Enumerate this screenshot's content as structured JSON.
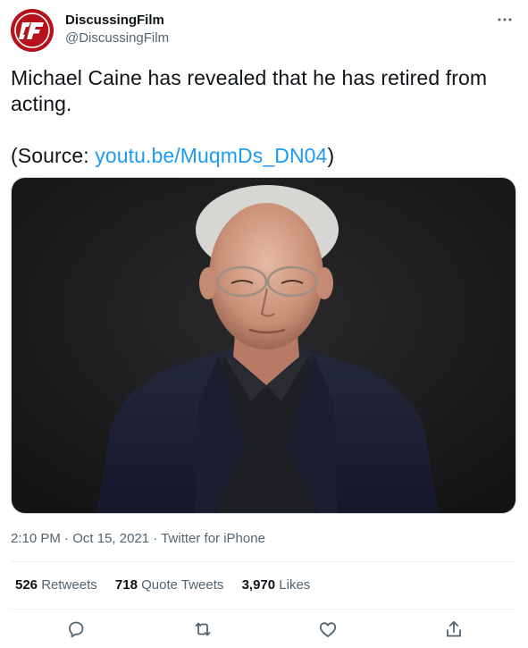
{
  "author": {
    "display_name": "DiscussingFilm",
    "handle": "@DiscussingFilm",
    "avatar_icon": "discussingfilm-logo-icon",
    "avatar_color": "#b5121b"
  },
  "menu": {
    "more_icon": "more-horizontal-icon"
  },
  "tweet": {
    "text": "Michael Caine has revealed that he has retired from acting.",
    "source_prefix": "(Source: ",
    "source_link": "youtu.be/MuqmDs_DN04",
    "source_suffix": ")",
    "link_color": "#1d9bf0"
  },
  "media": {
    "icon": "portrait-photo",
    "background_color": "#1b1b1d"
  },
  "meta": {
    "time": "2:10 PM",
    "separator": "·",
    "date": "Oct 15, 2021",
    "client": "Twitter for iPhone"
  },
  "stats": {
    "retweets_count": "526",
    "retweets_label": "Retweets",
    "quotes_count": "718",
    "quotes_label": "Quote Tweets",
    "likes_count": "3,970",
    "likes_label": "Likes"
  },
  "actions": {
    "reply_icon": "reply-icon",
    "retweet_icon": "retweet-icon",
    "like_icon": "heart-icon",
    "share_icon": "share-icon"
  }
}
